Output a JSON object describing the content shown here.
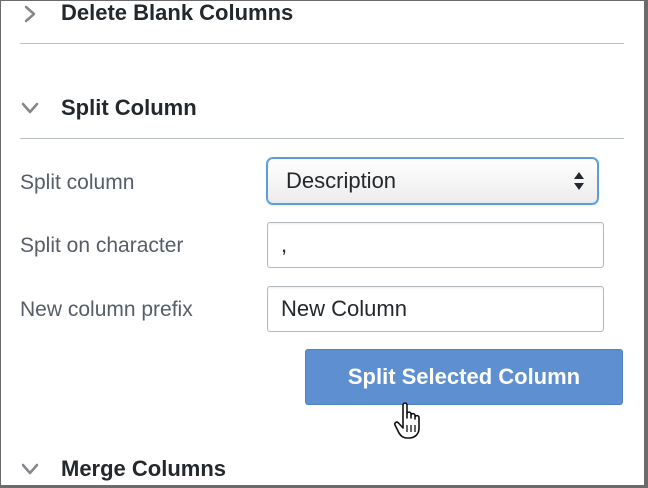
{
  "sections": {
    "delete_blank": {
      "title": "Delete Blank Columns",
      "icon": "chevron-right-icon"
    },
    "split": {
      "title": "Split Column",
      "icon": "chevron-down-icon"
    },
    "merge": {
      "title": "Merge Columns",
      "icon": "chevron-down-icon"
    }
  },
  "form": {
    "split_column_label": "Split column",
    "split_column_value": "Description",
    "split_char_label": "Split on character",
    "split_char_value": ",",
    "prefix_label": "New column prefix",
    "prefix_value": "New Column"
  },
  "button": {
    "label": "Split Selected Column"
  },
  "colors": {
    "accent": "#5e8fd0",
    "focus": "#5b9dd9",
    "heading": "#23282d",
    "label": "#555d66"
  },
  "cursor": "hand-pointer-icon"
}
